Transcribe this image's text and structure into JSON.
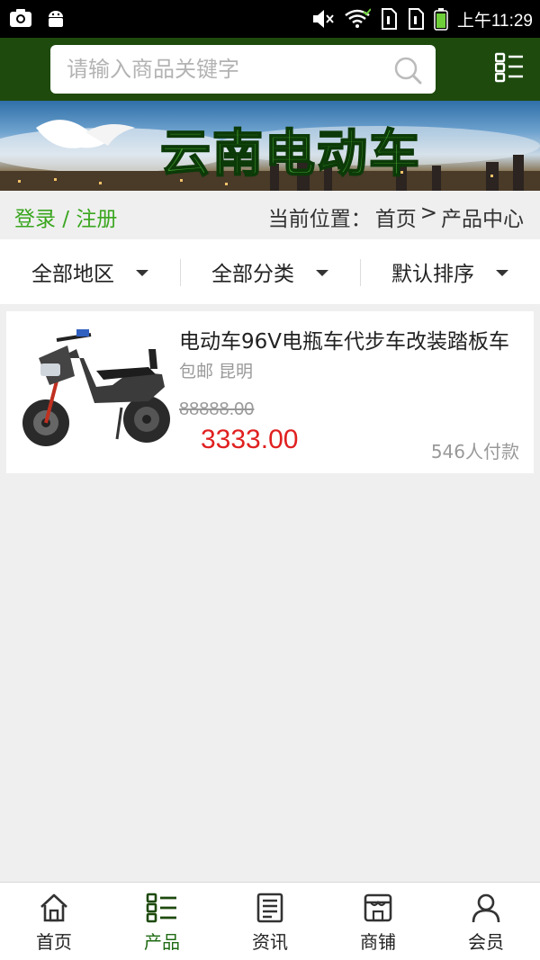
{
  "status_bar": {
    "time": "上午11:29"
  },
  "search": {
    "placeholder": "请输入商品关键字"
  },
  "banner": {
    "title": "云南电动车"
  },
  "location": {
    "login_label": "登录 / 注册",
    "prefix": "当前位置：",
    "home": "首页",
    "separator": ">",
    "current": "产品中心"
  },
  "filters": [
    {
      "label": "全部地区"
    },
    {
      "label": "全部分类"
    },
    {
      "label": "默认排序"
    }
  ],
  "products": [
    {
      "title": "电动车96V电瓶车代步车改装踏板车",
      "meta": "包邮 昆明",
      "old_price": "88888.00",
      "price": "3333.00",
      "sold": "546人付款"
    }
  ],
  "nav": [
    {
      "label": "首页",
      "icon": "home-icon"
    },
    {
      "label": "产品",
      "icon": "list-icon",
      "active": true
    },
    {
      "label": "资讯",
      "icon": "news-icon"
    },
    {
      "label": "商铺",
      "icon": "shop-icon"
    },
    {
      "label": "会员",
      "icon": "user-icon"
    }
  ],
  "colors": {
    "header": "#1e4a0e",
    "accent": "#3aa61f",
    "price": "#e02020"
  }
}
